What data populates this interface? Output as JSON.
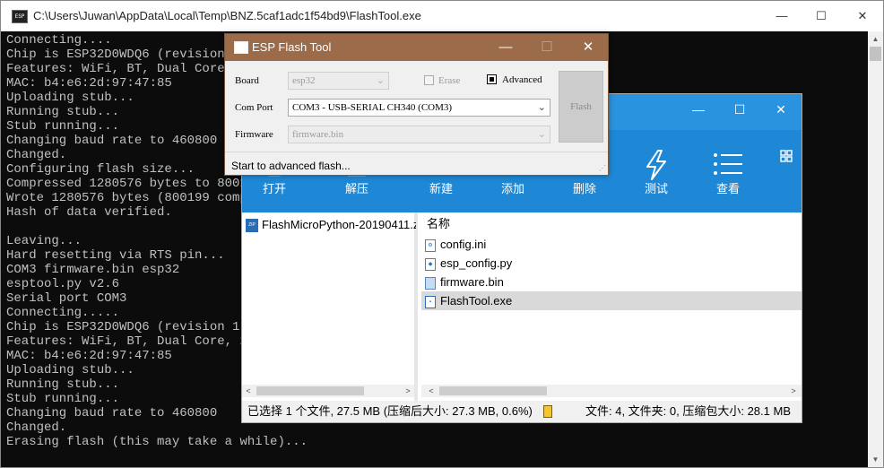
{
  "console": {
    "icon_label": "ESP",
    "title": "C:\\Users\\Juwan\\AppData\\Local\\Temp\\BNZ.5caf1adc1f54bd9\\FlashTool.exe",
    "minimize": "—",
    "maximize": "☐",
    "close": "✕",
    "lines": [
      "Connecting....",
      "Chip is ESP32D0WDQ6 (revision 1",
      "Features: WiFi, BT, Dual Core,",
      "MAC: b4:e6:2d:97:47:85",
      "Uploading stub...",
      "Running stub...",
      "Stub running...",
      "Changing baud rate to 460800",
      "Changed.",
      "Configuring flash size...",
      "Compressed 1280576 bytes to 80019",
      "Wrote 1280576 bytes (800199 compr",
      "Hash of data verified.",
      "",
      "Leaving...",
      "Hard resetting via RTS pin...",
      "COM3 firmware.bin esp32",
      "esptool.py v2.6",
      "Serial port COM3",
      "Connecting.....",
      "Chip is ESP32D0WDQ6 (revision 1)",
      "Features: WiFi, BT, Dual Core, 24",
      "MAC: b4:e6:2d:97:47:85",
      "Uploading stub...",
      "Running stub...",
      "Stub running...",
      "Changing baud rate to 460800",
      "Changed.",
      "Erasing flash (this may take a while)..."
    ]
  },
  "archive": {
    "minimize": "—",
    "maximize": "☐",
    "close": "✕",
    "toolbar": [
      {
        "name": "open",
        "label": "打开",
        "icon": "open-folder-icon"
      },
      {
        "name": "extract",
        "label": "解压",
        "icon": "extract-icon"
      },
      {
        "name": "new",
        "label": "新建",
        "icon": "new-archive-icon"
      },
      {
        "name": "add",
        "label": "添加",
        "icon": "add-icon"
      },
      {
        "name": "delete",
        "label": "删除",
        "icon": "delete-icon"
      },
      {
        "name": "test",
        "label": "测试",
        "icon": "lightning-icon"
      },
      {
        "name": "view",
        "label": "查看",
        "icon": "list-view-icon"
      }
    ],
    "tree_item": "FlashMicroPython-20190411.z",
    "zip_icon_text": "ZIP",
    "column_name": "名称",
    "files": [
      {
        "name": "config.ini",
        "icon": "ini-file-icon",
        "selected": false
      },
      {
        "name": "esp_config.py",
        "icon": "python-file-icon",
        "selected": false
      },
      {
        "name": "firmware.bin",
        "icon": "bin-file-icon",
        "selected": false
      },
      {
        "name": "FlashTool.exe",
        "icon": "exe-file-icon",
        "selected": true
      }
    ],
    "status_left": "已选择 1 个文件, 27.5 MB (压缩后大小: 27.3 MB, 0.6%)",
    "status_right": "文件: 4, 文件夹: 0, 压缩包大小: 28.1 MB"
  },
  "esp_tool": {
    "title": "ESP Flash Tool",
    "minimize": "—",
    "maximize": "☐",
    "close": "✕",
    "board_label": "Board",
    "board_value": "esp32",
    "erase_label": "Erase",
    "erase_checked": false,
    "advanced_label": "Advanced",
    "advanced_checked": true,
    "com_port_label": "Com Port",
    "com_port_value": "COM3 - USB-SERIAL CH340 (COM3)",
    "firmware_label": "Firmware",
    "firmware_value": "firmware.bin",
    "flash_button": "Flash",
    "status": "Start to advanced flash..."
  }
}
